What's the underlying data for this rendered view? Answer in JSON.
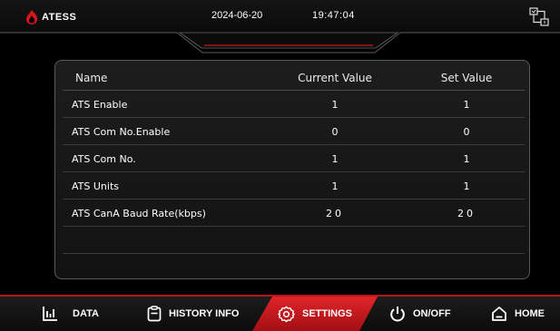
{
  "header": {
    "brand": "ATESS",
    "date": "2024-06-20",
    "time": "19:47:04"
  },
  "table": {
    "columns": [
      "Name",
      "Current Value",
      "Set Value"
    ],
    "rows": [
      {
        "name": "ATS Enable",
        "current": "1",
        "set": "1"
      },
      {
        "name": "ATS Com No.Enable",
        "current": "0",
        "set": "0"
      },
      {
        "name": "ATS Com No.",
        "current": "1",
        "set": "1"
      },
      {
        "name": "ATS Units",
        "current": "1",
        "set": "1"
      },
      {
        "name": "ATS CanA Baud Rate(kbps)",
        "current": "20",
        "set": "20"
      },
      {
        "name": "",
        "current": "",
        "set": ""
      },
      {
        "name": "",
        "current": "",
        "set": ""
      }
    ]
  },
  "nav": {
    "data": "DATA",
    "history": "HISTORY INFO",
    "settings": "SETTINGS",
    "onoff": "ON/OFF",
    "home": "HOME",
    "active": "settings"
  },
  "colors": {
    "accent": "#c8161b",
    "panel_border": "#5a5a5a",
    "background": "#000000"
  }
}
